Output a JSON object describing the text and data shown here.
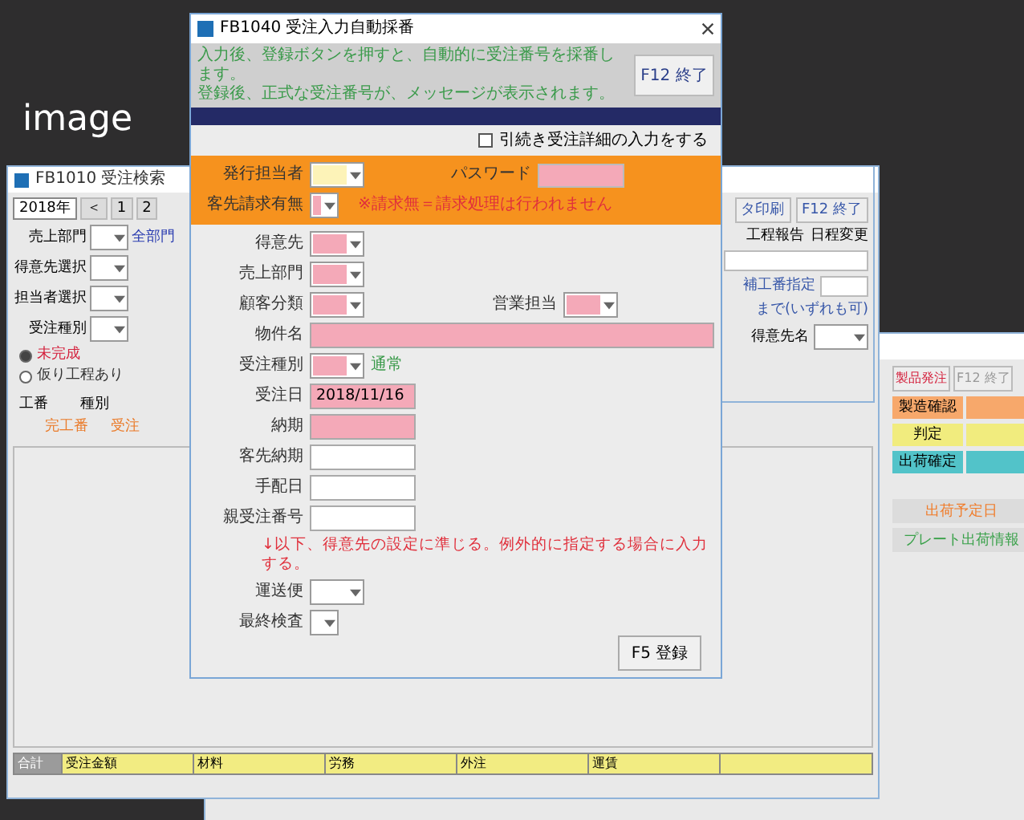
{
  "caption": "image",
  "search_window": {
    "title": "FB1010 受注検索",
    "tabs": [
      {
        "label": "2018年",
        "selected": true
      },
      {
        "label": "＜",
        "selected": false
      },
      {
        "label": "1",
        "selected": false
      },
      {
        "label": "2",
        "selected": false
      }
    ],
    "filters": [
      {
        "label": "売上部門",
        "note": "全部門"
      },
      {
        "label": "得意先選択"
      },
      {
        "label": "担当者選択"
      },
      {
        "label": "受注種別"
      }
    ],
    "radios": [
      {
        "label": "未完成",
        "selected": true
      },
      {
        "label": "仮り工程あり",
        "selected": false
      }
    ],
    "list_header": [
      "工番",
      "種別"
    ],
    "list_row": [
      "完工番",
      "受注"
    ],
    "totals": [
      {
        "label": "合計",
        "kind": "head"
      },
      {
        "label": "受注金額",
        "kind": "cell"
      },
      {
        "label": "材料",
        "kind": "cell"
      },
      {
        "label": "労務",
        "kind": "cell"
      },
      {
        "label": "外注",
        "kind": "cell"
      },
      {
        "label": "運賃",
        "kind": "cell"
      }
    ]
  },
  "detail_window": {
    "buttons": [
      "タ印刷",
      "F12 終了"
    ],
    "tabs": [
      "工程報告",
      "日程変更"
    ],
    "range_label": "補工番指定",
    "range_note": "まで(いずれも可)",
    "customer_label": "得意先名"
  },
  "status_window": {
    "buttons": [
      {
        "label": "製品発注",
        "kind": "alert"
      },
      {
        "label": "F12 終了",
        "kind": "plain"
      }
    ],
    "legend": [
      {
        "label": "製造確認",
        "color": "#f7a86b"
      },
      {
        "label": "判定",
        "color": "#f1ec7e"
      },
      {
        "label": "出荷確定",
        "color": "#52c3c9"
      }
    ],
    "actions": [
      {
        "label": "出荷予定日",
        "kind": "orange"
      },
      {
        "label": "プレート出荷情報",
        "kind": "green"
      }
    ]
  },
  "dialog": {
    "title": "FB1040 受注入力自動採番",
    "info_lines": [
      "入力後、登録ボタンを押すと、自動的に受注番号を採番します。",
      "登録後、正式な受注番号が、メッセージが表示されます。"
    ],
    "close_button": "F12 終了",
    "continue_check": {
      "label": "引続き受注詳細の入力をする",
      "checked": false
    },
    "issuer": {
      "label": "発行担当者",
      "focused": true
    },
    "password": {
      "label": "パスワード",
      "required": true
    },
    "billing": {
      "label": "客先請求有無",
      "required": true
    },
    "billing_note": "※請求無＝請求処理は行われません",
    "fields": [
      {
        "kind": "combo",
        "label": "得意先",
        "required": true
      },
      {
        "kind": "combo",
        "label": "売上部門",
        "required": true
      },
      {
        "kind": "combo",
        "label": "顧客分類",
        "required": true,
        "side": {
          "label": "営業担当",
          "required": true
        }
      },
      {
        "kind": "text_wide",
        "label": "物件名",
        "required": true
      },
      {
        "kind": "combo",
        "label": "受注種別",
        "required": true,
        "note": "通常"
      },
      {
        "kind": "text",
        "label": "受注日",
        "required": true,
        "value": "2018/11/16"
      },
      {
        "kind": "text",
        "label": "納期",
        "required": true
      },
      {
        "kind": "text",
        "label": "客先納期",
        "required": false
      },
      {
        "kind": "text",
        "label": "手配日",
        "required": false
      },
      {
        "kind": "text",
        "label": "親受注番号",
        "required": false
      },
      {
        "kind": "note",
        "text": "↓以下、得意先の設定に準じる。例外的に指定する場合に入力する。"
      },
      {
        "kind": "combo",
        "label": "運送便",
        "required": false
      },
      {
        "kind": "combo_small",
        "label": "最終検査",
        "required": false
      }
    ],
    "register_button": "F5 登録"
  }
}
